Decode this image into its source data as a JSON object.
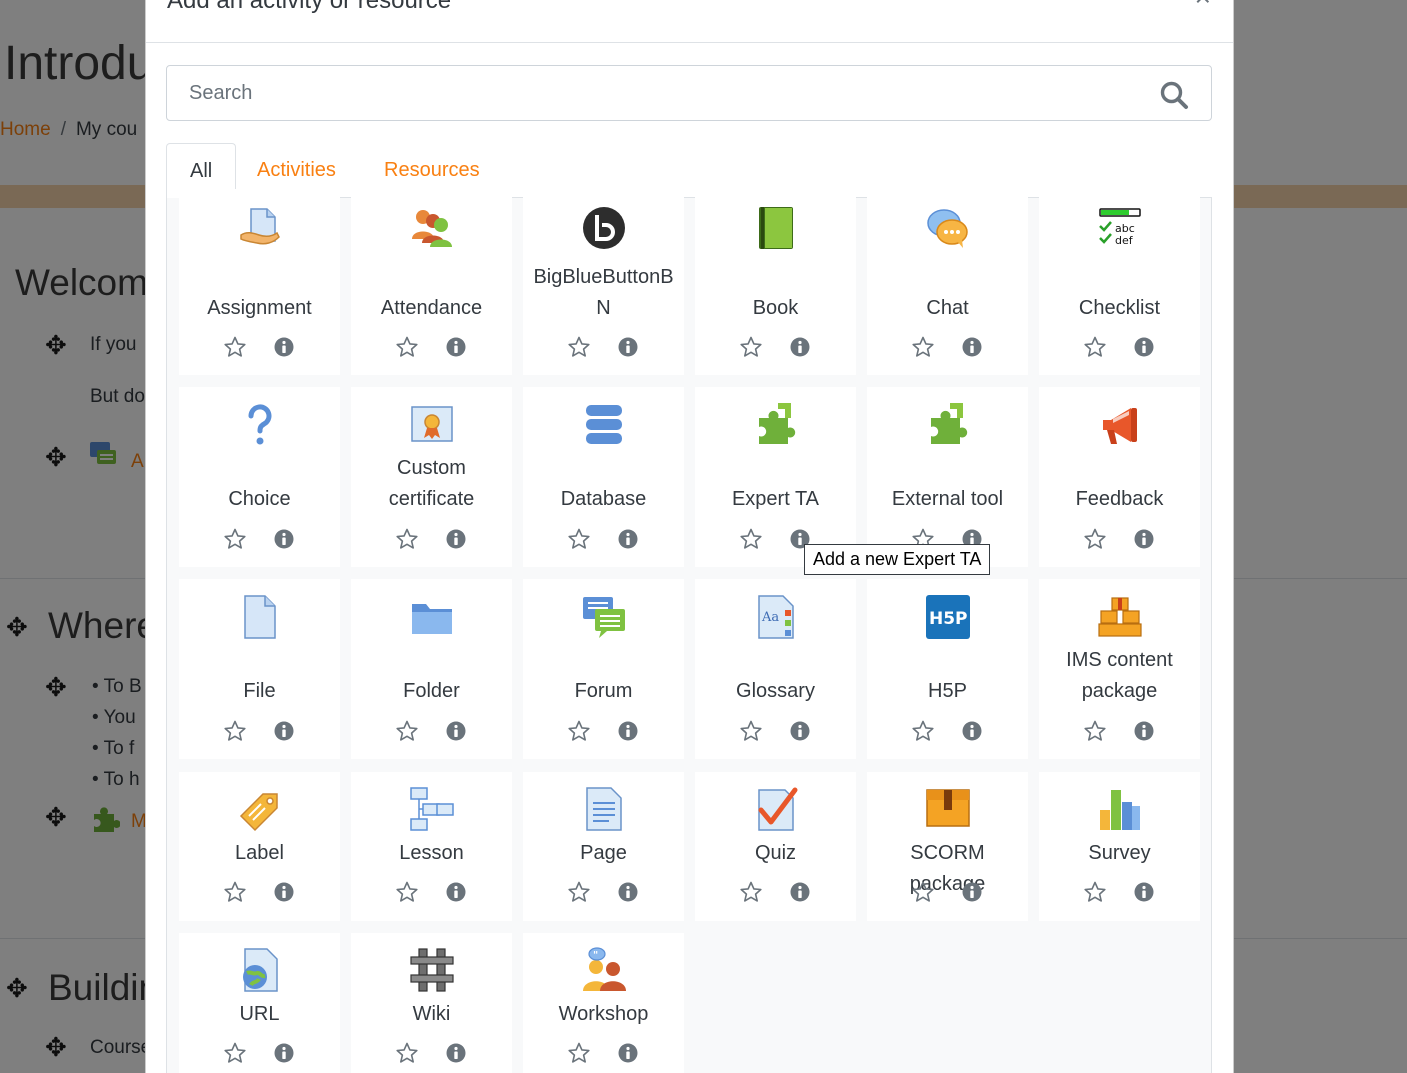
{
  "background": {
    "course_title": "Introdu",
    "breadcrumb": {
      "home": "Home",
      "separator": "/",
      "current": "My cou"
    },
    "sections": {
      "welcome_heading": "Welcome",
      "welcome_text_1": "If you",
      "welcome_text_2": "But do",
      "welcome_link": "A",
      "where_heading": "Where",
      "bullet_1": "To B",
      "bullet_2": "You",
      "bullet_3": "To f",
      "bullet_4": "To h",
      "where_link": "M",
      "building_heading": "Buildin",
      "building_text": "Course"
    }
  },
  "modal": {
    "title": "Add an activity or resource",
    "close_label": "×",
    "search": {
      "placeholder": "Search"
    },
    "tabs": [
      {
        "label": "All",
        "active": true
      },
      {
        "label": "Activities",
        "active": false
      },
      {
        "label": "Resources",
        "active": false
      }
    ],
    "tooltip": "Add a new Expert TA",
    "modules": [
      {
        "name": "Assignment",
        "icon": "assignment-icon"
      },
      {
        "name": "Attendance",
        "icon": "attendance-icon"
      },
      {
        "name": "BigBlueButtonBN",
        "icon": "bigbluebutton-icon"
      },
      {
        "name": "Book",
        "icon": "book-icon"
      },
      {
        "name": "Chat",
        "icon": "chat-icon"
      },
      {
        "name": "Checklist",
        "icon": "checklist-icon"
      },
      {
        "name": "Choice",
        "icon": "choice-icon"
      },
      {
        "name": "Custom certificate",
        "icon": "certificate-icon"
      },
      {
        "name": "Database",
        "icon": "database-icon"
      },
      {
        "name": "Expert TA",
        "icon": "puzzle-icon"
      },
      {
        "name": "External tool",
        "icon": "puzzle-icon"
      },
      {
        "name": "Feedback",
        "icon": "megaphone-icon"
      },
      {
        "name": "File",
        "icon": "file-icon"
      },
      {
        "name": "Folder",
        "icon": "folder-icon"
      },
      {
        "name": "Forum",
        "icon": "forum-icon"
      },
      {
        "name": "Glossary",
        "icon": "glossary-icon"
      },
      {
        "name": "H5P",
        "icon": "h5p-icon"
      },
      {
        "name": "IMS content package",
        "icon": "ims-package-icon"
      },
      {
        "name": "Label",
        "icon": "label-icon"
      },
      {
        "name": "Lesson",
        "icon": "lesson-icon"
      },
      {
        "name": "Page",
        "icon": "page-icon"
      },
      {
        "name": "Quiz",
        "icon": "quiz-icon"
      },
      {
        "name": "SCORM package",
        "icon": "scorm-icon"
      },
      {
        "name": "Survey",
        "icon": "survey-icon"
      },
      {
        "name": "URL",
        "icon": "url-icon"
      },
      {
        "name": "Wiki",
        "icon": "wiki-icon"
      },
      {
        "name": "Workshop",
        "icon": "workshop-icon"
      }
    ],
    "colors": {
      "accent": "#f98012",
      "text": "#343a40",
      "icon_grey": "#6a737b"
    }
  }
}
